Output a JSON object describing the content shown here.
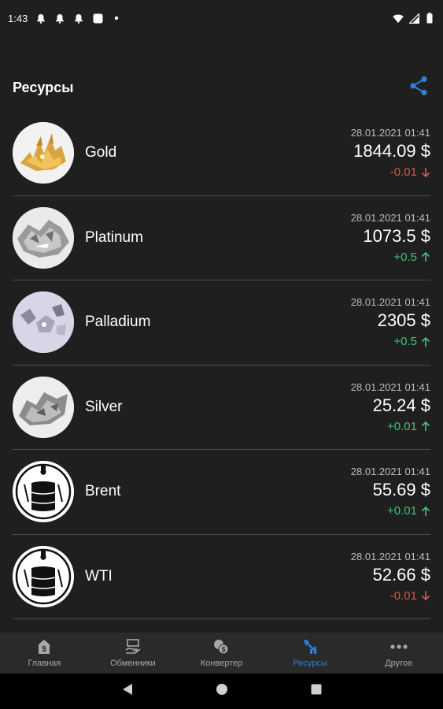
{
  "status_bar": {
    "time": "1:43",
    "icons": [
      "notification-bell-icon",
      "notification-bell-icon",
      "notification-bell-icon",
      "app-square-icon",
      "dot-icon"
    ],
    "right_icons": [
      "wifi-icon",
      "cellular-signal-icon",
      "battery-icon"
    ]
  },
  "header": {
    "title": "Ресурсы",
    "share_icon": "share-icon"
  },
  "resources": [
    {
      "name": "Gold",
      "date": "28.01.2021 01:41",
      "price": "1844.09 $",
      "change": "-0.01",
      "direction": "down",
      "image": "gold-image"
    },
    {
      "name": "Platinum",
      "date": "28.01.2021 01:41",
      "price": "1073.5 $",
      "change": "+0.5",
      "direction": "up",
      "image": "platinum-image"
    },
    {
      "name": "Palladium",
      "date": "28.01.2021 01:41",
      "price": "2305 $",
      "change": "+0.5",
      "direction": "up",
      "image": "palladium-image"
    },
    {
      "name": "Silver",
      "date": "28.01.2021 01:41",
      "price": "25.24 $",
      "change": "+0.01",
      "direction": "up",
      "image": "silver-image"
    },
    {
      "name": "Brent",
      "date": "28.01.2021 01:41",
      "price": "55.69 $",
      "change": "+0.01",
      "direction": "up",
      "image": "brent-oil-barrel-image"
    },
    {
      "name": "WTI",
      "date": "28.01.2021 01:41",
      "price": "52.66 $",
      "change": "-0.01",
      "direction": "down",
      "image": "wti-oil-barrel-image"
    }
  ],
  "nav": {
    "items": [
      {
        "label": "Главная",
        "icon": "home-dollar-icon",
        "active": false
      },
      {
        "label": "Обменники",
        "icon": "exchange-hand-icon",
        "active": false
      },
      {
        "label": "Конвертер",
        "icon": "converter-coins-icon",
        "active": false
      },
      {
        "label": "Ресурсы",
        "icon": "resources-icon",
        "active": true
      },
      {
        "label": "Другое",
        "icon": "more-dots-icon",
        "active": false
      }
    ]
  },
  "colors": {
    "background": "#1f1f1f",
    "accent": "#2f7fd8",
    "up": "#43c47a",
    "down": "#e05252"
  }
}
